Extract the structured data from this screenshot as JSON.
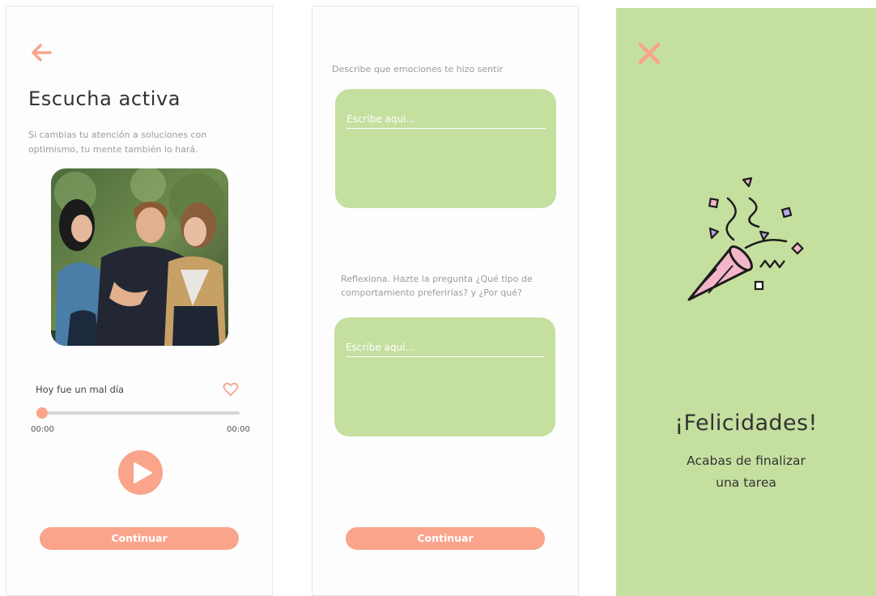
{
  "colors": {
    "accent": "#f9a48b",
    "green": "#c5df9f",
    "text_dark": "#333333",
    "text_muted": "#9c9c9c"
  },
  "screen1": {
    "icons": {
      "back": "arrow-left-icon",
      "favorite": "heart-outline-icon",
      "play": "play-icon"
    },
    "title": "Escucha activa",
    "subtitle": "Si cambias tu atención a soluciones con optimismo, tu mente también lo hará.",
    "image": {
      "description": "three-friends-photo"
    },
    "track_title": "Hoy fue un mal día",
    "progress": 0,
    "time_elapsed": "00:00",
    "time_total": "00:00",
    "continue_label": "Continuar"
  },
  "screen2": {
    "prompt1": "Describe que emociones te hizo sentir",
    "input1_placeholder": "Escribe aqui...",
    "prompt2": "Reflexiona. Hazte la pregunta ¿Qué tipo de comportamiento preferirías? y ¿Por qué?",
    "input2_placeholder": "Escribe aqui...",
    "continue_label": "Continuar"
  },
  "screen3": {
    "icons": {
      "close": "close-icon",
      "celebration": "party-popper-icon"
    },
    "title": "¡Felicidades!",
    "message_line1": "Acabas de finalizar",
    "message_line2": "una tarea"
  }
}
